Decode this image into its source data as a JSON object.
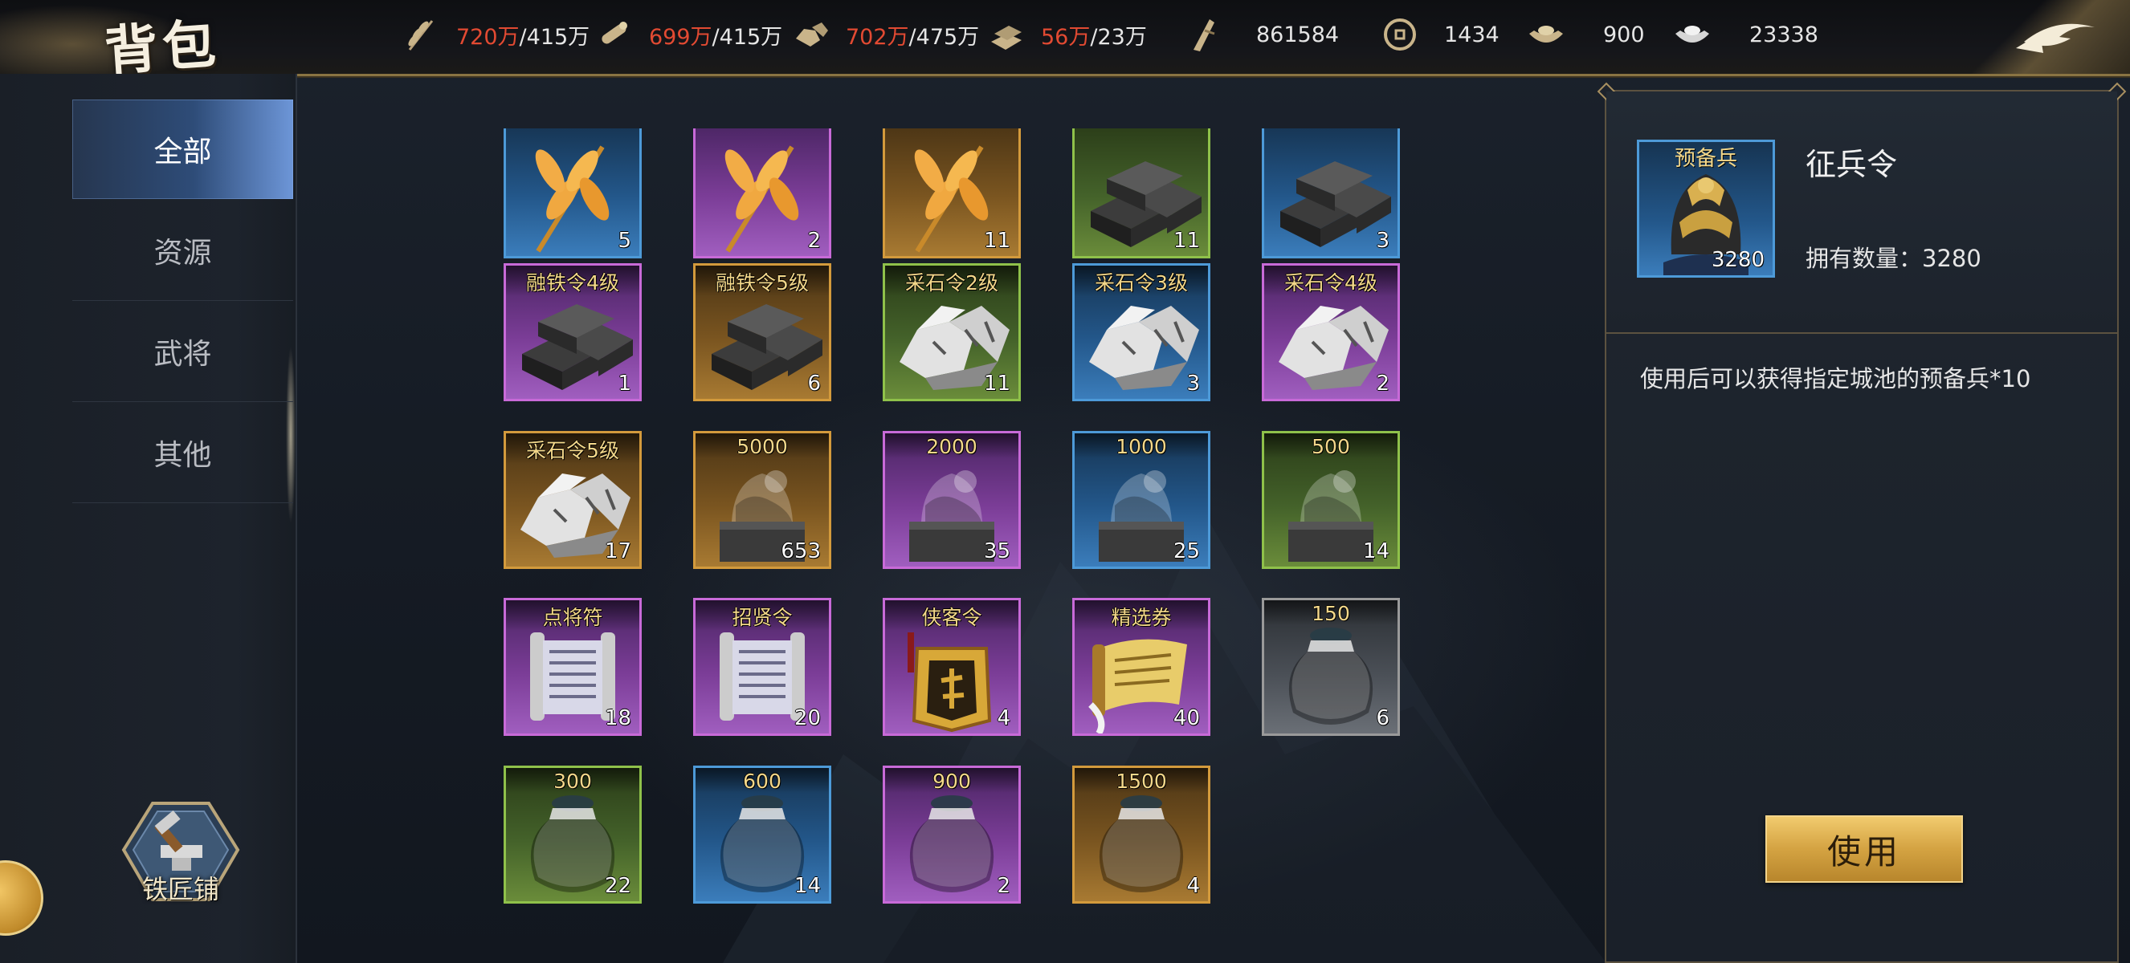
{
  "header": {
    "title": "背包",
    "resources": [
      {
        "icon": "grain-icon",
        "current": "720万",
        "capacity": "/415万"
      },
      {
        "icon": "wood-icon",
        "current": "699万",
        "capacity": "/415万"
      },
      {
        "icon": "stone-icon",
        "current": "702万",
        "capacity": "/475万"
      },
      {
        "icon": "iron-icon",
        "current": "56万",
        "capacity": "/23万"
      },
      {
        "icon": "decree-icon",
        "value": "861584"
      },
      {
        "icon": "copper-coin-icon",
        "value": "1434"
      },
      {
        "icon": "gold-ingot-icon",
        "value": "900"
      },
      {
        "icon": "silver-ingot-icon",
        "value": "23338"
      }
    ],
    "back_icon": "back-arrow-icon"
  },
  "sidebar": {
    "tabs": [
      {
        "label": "全部",
        "active": true
      },
      {
        "label": "资源",
        "active": false
      },
      {
        "label": "武将",
        "active": false
      },
      {
        "label": "其他",
        "active": false
      }
    ],
    "blacksmith_label": "铁匠铺"
  },
  "items": [
    {
      "icon": "grain-icon",
      "tag": "",
      "count": "5",
      "rarity": "blue"
    },
    {
      "icon": "grain-icon",
      "tag": "",
      "count": "2",
      "rarity": "purple"
    },
    {
      "icon": "grain-icon",
      "tag": "",
      "count": "11",
      "rarity": "gold"
    },
    {
      "icon": "iron-ingot-icon",
      "tag": "",
      "count": "11",
      "rarity": "green"
    },
    {
      "icon": "iron-ingot-icon",
      "tag": "",
      "count": "3",
      "rarity": "blue"
    },
    {
      "icon": "iron-ingot-icon",
      "tag": "融铁令4级",
      "count": "1",
      "rarity": "purple"
    },
    {
      "icon": "iron-ingot-icon",
      "tag": "融铁令5级",
      "count": "6",
      "rarity": "gold"
    },
    {
      "icon": "stone-ore-icon",
      "tag": "采石令2级",
      "count": "11",
      "rarity": "green"
    },
    {
      "icon": "stone-ore-icon",
      "tag": "采石令3级",
      "count": "3",
      "rarity": "blue"
    },
    {
      "icon": "stone-ore-icon",
      "tag": "采石令4级",
      "count": "2",
      "rarity": "purple"
    },
    {
      "icon": "stone-ore-icon",
      "tag": "采石令5级",
      "count": "17",
      "rarity": "gold"
    },
    {
      "icon": "seal-icon",
      "tag": "5000",
      "count": "653",
      "rarity": "gold"
    },
    {
      "icon": "seal-icon",
      "tag": "2000",
      "count": "35",
      "rarity": "purple"
    },
    {
      "icon": "seal-icon",
      "tag": "1000",
      "count": "25",
      "rarity": "blue"
    },
    {
      "icon": "seal-icon",
      "tag": "500",
      "count": "14",
      "rarity": "green"
    },
    {
      "icon": "scroll-icon",
      "tag": "点将符",
      "count": "18",
      "rarity": "purple"
    },
    {
      "icon": "scroll-icon",
      "tag": "招贤令",
      "count": "20",
      "rarity": "purple"
    },
    {
      "icon": "token-icon",
      "tag": "侠客令",
      "count": "4",
      "rarity": "purple"
    },
    {
      "icon": "paper-scroll-icon",
      "tag": "精选券",
      "count": "40",
      "rarity": "purple"
    },
    {
      "icon": "jar-icon",
      "tag": "150",
      "count": "6",
      "rarity": "gray"
    },
    {
      "icon": "jar-icon",
      "tag": "300",
      "count": "22",
      "rarity": "green"
    },
    {
      "icon": "jar-icon",
      "tag": "600",
      "count": "14",
      "rarity": "blue"
    },
    {
      "icon": "jar-icon",
      "tag": "900",
      "count": "2",
      "rarity": "purple"
    },
    {
      "icon": "jar-icon",
      "tag": "1500",
      "count": "4",
      "rarity": "gold"
    }
  ],
  "detail": {
    "icon": "helmet-icon",
    "tag": "预备兵",
    "count": "3280",
    "name": "征兵令",
    "owned_label": "拥有数量：3280",
    "description": "使用后可以获得指定城池的预备兵*10",
    "use_label": "使用"
  }
}
